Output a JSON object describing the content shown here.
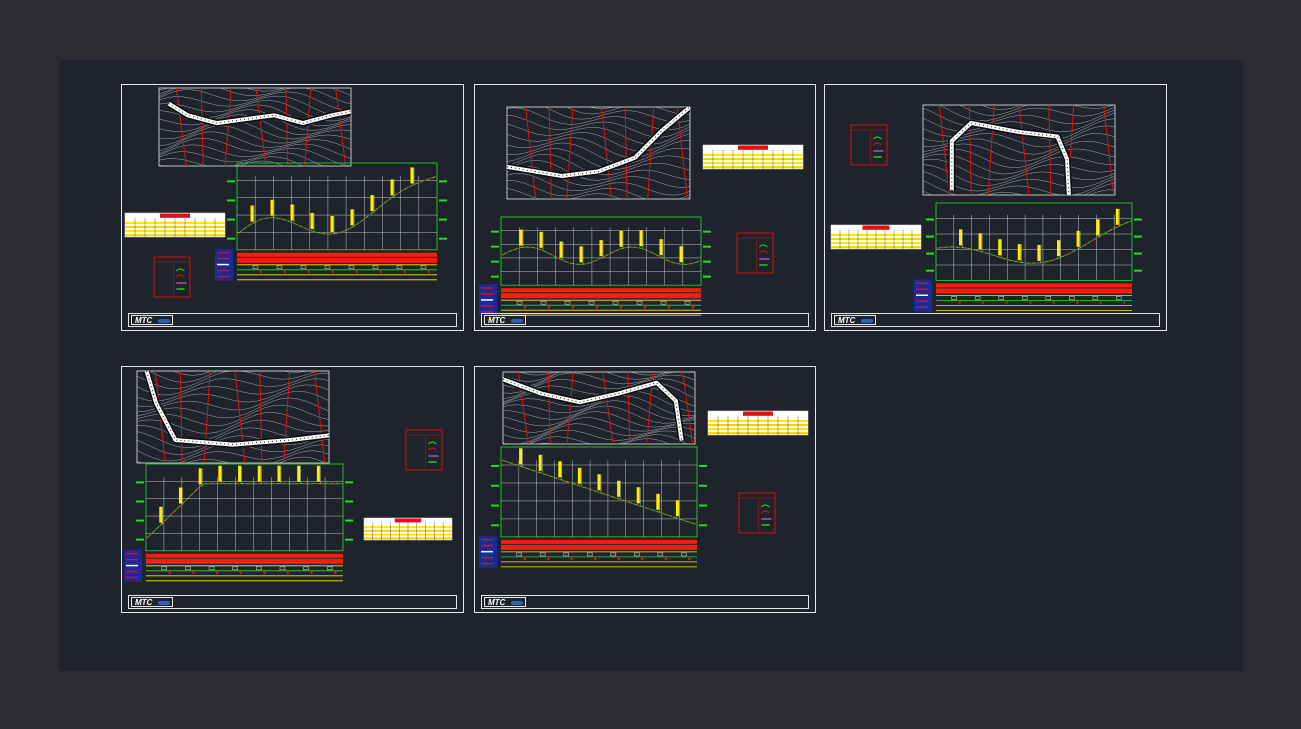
{
  "viewport": {
    "title": "",
    "background": "#2e2a31",
    "canvas_color": "#1f242c"
  },
  "title_block": {
    "logo_text": "MTC"
  },
  "colors": {
    "border": "#e8e8e8",
    "contour": "#cfd4d8",
    "road": "#ffffff",
    "grid_red": "#e01010",
    "profile_green": "#22dd22",
    "grid_white": "#bfc3c8",
    "marker_yellow": "#ffee00",
    "band_red": "#ff1a0a",
    "band_yellow": "#ffe600",
    "legend_red": "#cc1111",
    "legend_blue": "#1a2a9a"
  },
  "sheets": [
    {
      "id": "lamina-1",
      "icons": [
        "plan-view-icon",
        "longitudinal-profile-icon",
        "curve-table-icon",
        "legend-icon"
      ]
    },
    {
      "id": "lamina-2",
      "icons": [
        "plan-view-icon",
        "longitudinal-profile-icon",
        "curve-table-icon",
        "legend-icon"
      ]
    },
    {
      "id": "lamina-3",
      "icons": [
        "plan-view-icon",
        "longitudinal-profile-icon",
        "curve-table-icon",
        "legend-icon"
      ]
    },
    {
      "id": "lamina-4",
      "icons": [
        "plan-view-icon",
        "longitudinal-profile-icon",
        "curve-table-icon",
        "legend-icon"
      ]
    },
    {
      "id": "lamina-5",
      "icons": [
        "plan-view-icon",
        "longitudinal-profile-icon",
        "curve-table-icon",
        "legend-icon"
      ]
    }
  ]
}
